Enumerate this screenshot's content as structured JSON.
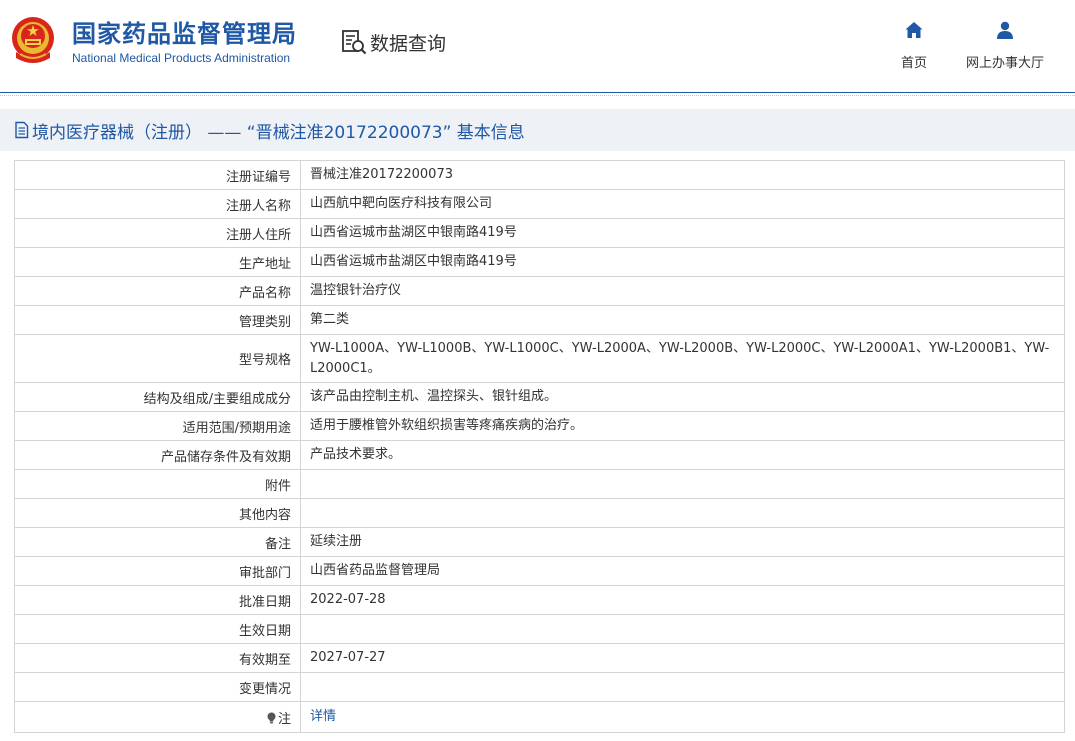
{
  "header": {
    "brand_cn": "国家药品监督管理局",
    "brand_en": "National Medical Products Administration",
    "query_label": "数据查询",
    "nav": {
      "home": "首页",
      "online_hall": "网上办事大厅"
    },
    "brand_color": "#1f58a5",
    "emblem_icon": "national-emblem-icon"
  },
  "title_bar": {
    "text": "境内医疗器械（注册） ——  “晋械注准20172200073”  基本信息",
    "icon": "document-icon"
  },
  "rows": [
    {
      "label": "注册证编号",
      "value": "晋械注准20172200073"
    },
    {
      "label": "注册人名称",
      "value": "山西航中靶向医疗科技有限公司"
    },
    {
      "label": "注册人住所",
      "value": "山西省运城市盐湖区中银南路419号"
    },
    {
      "label": "生产地址",
      "value": "山西省运城市盐湖区中银南路419号"
    },
    {
      "label": "产品名称",
      "value": "温控银针治疗仪"
    },
    {
      "label": "管理类别",
      "value": "第二类"
    },
    {
      "label": "型号规格",
      "value": "YW-L1000A、YW-L1000B、YW-L1000C、YW-L2000A、YW-L2000B、YW-L2000C、YW-L2000A1、YW-L2000B1、YW-L2000C1。"
    },
    {
      "label": "结构及组成/主要组成成分",
      "value": "该产品由控制主机、温控探头、银针组成。"
    },
    {
      "label": "适用范围/预期用途",
      "value": "适用于腰椎管外软组织损害等疼痛疾病的治疗。"
    },
    {
      "label": "产品储存条件及有效期",
      "value": "产品技术要求。"
    },
    {
      "label": "附件",
      "value": ""
    },
    {
      "label": "其他内容",
      "value": ""
    },
    {
      "label": "备注",
      "value": "延续注册"
    },
    {
      "label": "审批部门",
      "value": "山西省药品监督管理局"
    },
    {
      "label": "批准日期",
      "value": "2022-07-28"
    },
    {
      "label": "生效日期",
      "value": ""
    },
    {
      "label": "有效期至",
      "value": "2027-07-27"
    },
    {
      "label": "变更情况",
      "value": ""
    }
  ],
  "note_row": {
    "label": "注",
    "link_text": "详情",
    "icon": "lightbulb-icon"
  }
}
